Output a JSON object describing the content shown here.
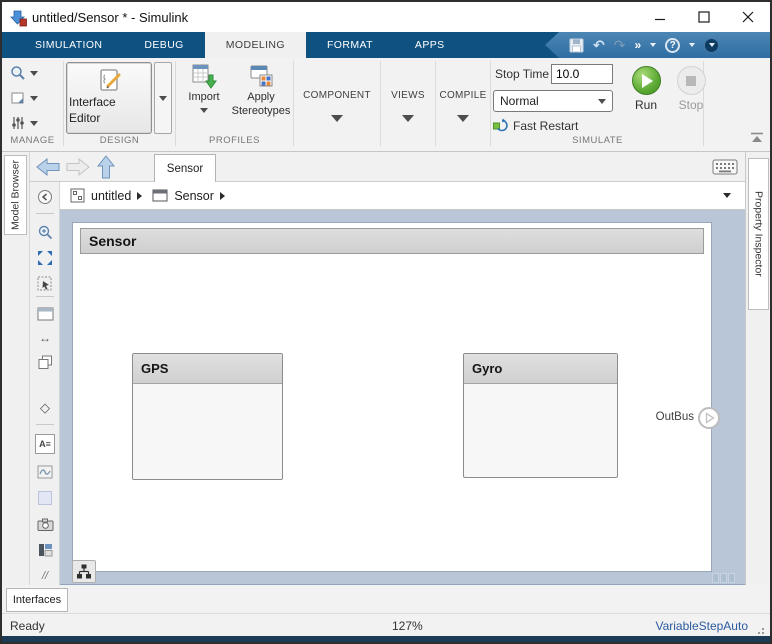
{
  "titlebar": {
    "title": "untitled/Sensor * - Simulink"
  },
  "ribbon": {
    "tabs": [
      {
        "label": "SIMULATION",
        "active": false
      },
      {
        "label": "DEBUG",
        "active": false
      },
      {
        "label": "MODELING",
        "active": true
      },
      {
        "label": "FORMAT",
        "active": false
      },
      {
        "label": "APPS",
        "active": false
      }
    ],
    "customize_glyph": "»",
    "help_glyph": "?"
  },
  "toolstrip": {
    "manage_label": "MANAGE",
    "design_label": "DESIGN",
    "interface_editor_label": "Interface Editor",
    "profiles_label": "PROFILES",
    "import_label": "Import",
    "apply_stereotypes_label": "Apply Stereotypes",
    "component_label": "COMPONENT",
    "views_label": "VIEWS",
    "compile_label": "COMPILE",
    "simulate_label": "SIMULATE",
    "stop_time_label": "Stop Time",
    "stop_time_value": "10.0",
    "sim_mode": "Normal",
    "fast_restart_label": "Fast Restart",
    "run_label": "Run",
    "stop_label": "Stop"
  },
  "nav": {
    "document_tab": "Sensor"
  },
  "breadcrumb": {
    "root": "untitled",
    "current": "Sensor"
  },
  "side_panels": {
    "left_tab": "Model Browser",
    "right_tab": "Property Inspector",
    "bottom_tab": "Interfaces"
  },
  "canvas": {
    "component_header": "Sensor",
    "blocks": [
      {
        "name": "GPS"
      },
      {
        "name": "Gyro"
      }
    ],
    "output_port": "OutBus"
  },
  "statusbar": {
    "status": "Ready",
    "zoom": "127%",
    "solver": "VariableStepAuto"
  },
  "glyphs": {
    "undo": "↶",
    "redo": "↷",
    "arrows_lr": "↔",
    "diamond": "◇",
    "annotation": "A≡",
    "handle": "//"
  },
  "icons": [
    "simulink-logo-icon",
    "minimize-icon",
    "maximize-icon",
    "close-icon",
    "save-icon",
    "undo-icon",
    "redo-icon",
    "customize-icon",
    "help-icon",
    "hide-ribbon-icon",
    "search-icon",
    "screenshot-icon",
    "sliders-icon",
    "interface-editor-icon",
    "import-icon",
    "apply-stereotypes-icon",
    "fast-restart-icon",
    "run-icon",
    "stop-icon",
    "collapse-toolstrip-icon",
    "back-icon",
    "forward-icon",
    "up-icon",
    "keyboard-icon",
    "model-badge-icon",
    "subsystem-badge-icon",
    "collapse-breadcrumb-icon",
    "zoom-in-icon",
    "fit-view-icon",
    "select-region-icon",
    "subsystem-icon",
    "resize-arrows-icon",
    "copy-icon",
    "diamond-icon",
    "annotation-icon",
    "signal-viewer-icon",
    "blank-square-icon",
    "camera-icon",
    "viewmarks-icon",
    "hierarchy-tree-icon",
    "outbus-port-icon"
  ],
  "colors": {
    "ribbon_blue": "#0f5181",
    "ribbon_chevron": "#3d7bae",
    "canvas_margin": "#b9c6d7",
    "run_green": "#55a02e",
    "solver_text": "#2b5aa0",
    "block_header": "#d8d8d8",
    "active_tab_bg": "#f0f0f0"
  }
}
